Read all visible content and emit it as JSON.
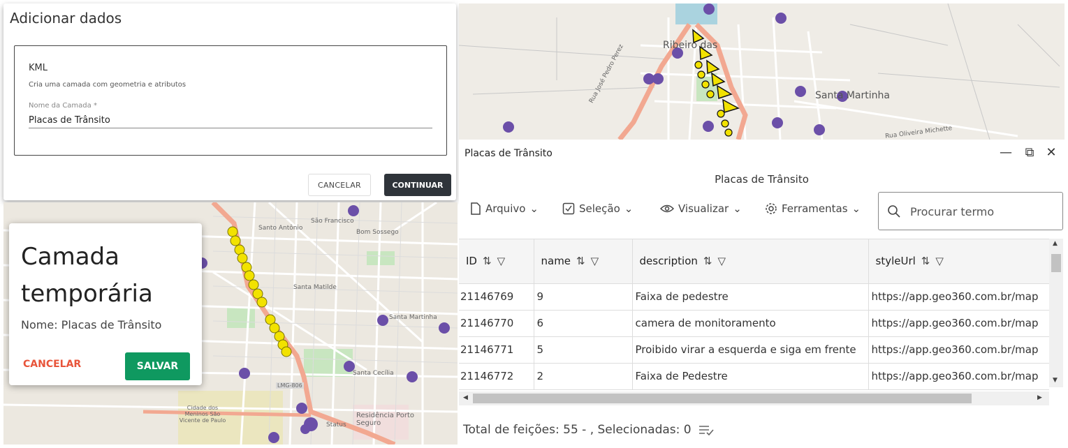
{
  "add_dialog": {
    "title": "Adicionar dados",
    "kml_label": "KML",
    "kml_description": "Cria uma camada com geometria e atributos",
    "layer_name_label": "Nome da Camada *",
    "layer_name_value": "Placas de Trânsito",
    "cancel_label": "CANCELAR",
    "continue_label": "CONTINUAR"
  },
  "temp_layer": {
    "title": "Camada temporária",
    "name_text": "Nome: Placas de Trânsito",
    "cancel_label": "CANCELAR",
    "save_label": "SALVAR"
  },
  "map_top": {
    "labels": [
      "Ribeiro das",
      "Santa Martinha",
      "Rua José Pedro Perez",
      "Rua Oliveira Michette"
    ]
  },
  "map_bottom": {
    "labels": [
      "Santo Antônio",
      "São Francisco",
      "Bom Sossego",
      "Santa Matilde",
      "Santa Martinha",
      "Santa Cecília",
      "Cidade dos Meninos São Vicente de Paulo",
      "Residência Porto Seguro",
      "LMG-806",
      "Status"
    ]
  },
  "table_window": {
    "title": "Placas de Trânsito",
    "subtitle": "Placas de Trânsito",
    "toolbar": {
      "arquivo": "Arquivo",
      "selecao": "Seleção",
      "visualizar": "Visualizar",
      "ferramentas": "Ferramentas"
    },
    "search_placeholder": "Procurar termo",
    "columns": [
      "ID",
      "name",
      "description",
      "styleUrl"
    ],
    "rows": [
      [
        "21146769",
        "9",
        "Faixa de pedestre",
        "https://app.geo360.com.br/map"
      ],
      [
        "21146770",
        "6",
        "camera de monitoramento",
        "https://app.geo360.com.br/map"
      ],
      [
        "21146771",
        "5",
        "Proibido virar a esquerda e siga em frente",
        "https://app.geo360.com.br/map"
      ],
      [
        "21146772",
        "2",
        "Faixa de Pedestre",
        "https://app.geo360.com.br/map"
      ]
    ],
    "footer": "Total de feições: 55 - , Selecionadas: 0"
  },
  "colors": {
    "primary_dark": "#2f343a",
    "save_green": "#0f9960",
    "cancel_red": "#e8543a",
    "poi_purple": "#6b4fa8",
    "marker_yellow": "#f2e200"
  }
}
